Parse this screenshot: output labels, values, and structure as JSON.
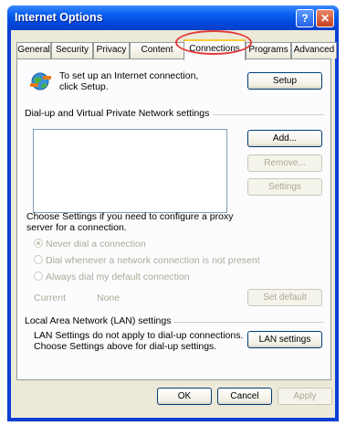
{
  "window": {
    "title": "Internet Options",
    "help_label": "?",
    "close_label": "✕"
  },
  "tabs": [
    {
      "label": "General"
    },
    {
      "label": "Security"
    },
    {
      "label": "Privacy"
    },
    {
      "label": "Content"
    },
    {
      "label": "Connections",
      "active": true
    },
    {
      "label": "Programs"
    },
    {
      "label": "Advanced"
    }
  ],
  "setup": {
    "text": "To set up an Internet connection, click Setup.",
    "button": "Setup",
    "icon": "globe-network-icon"
  },
  "dialup": {
    "heading": "Dial-up and Virtual Private Network settings",
    "add_button": "Add...",
    "remove_button": "Remove...",
    "settings_button": "Settings"
  },
  "proxy": {
    "text_line1": "Choose Settings if you need to configure a proxy",
    "text_line2": "server for a connection.",
    "options": [
      {
        "label": "Never dial a connection",
        "selected": true
      },
      {
        "label": "Dial whenever a network connection is not present",
        "selected": false
      },
      {
        "label": "Always dial my default connection",
        "selected": false
      }
    ],
    "current_label": "Current",
    "current_value": "None",
    "set_default_button": "Set default"
  },
  "lan": {
    "heading": "Local Area Network (LAN) settings",
    "text_line1": "LAN Settings do not apply to dial-up connections.",
    "text_line2": "Choose Settings above for dial-up settings.",
    "button": "LAN settings"
  },
  "footer": {
    "ok": "OK",
    "cancel": "Cancel",
    "apply": "Apply"
  },
  "colors": {
    "titlebar": "#0a5ff0",
    "dialog_bg": "#ece9d8",
    "highlight": "#e23a3a"
  }
}
